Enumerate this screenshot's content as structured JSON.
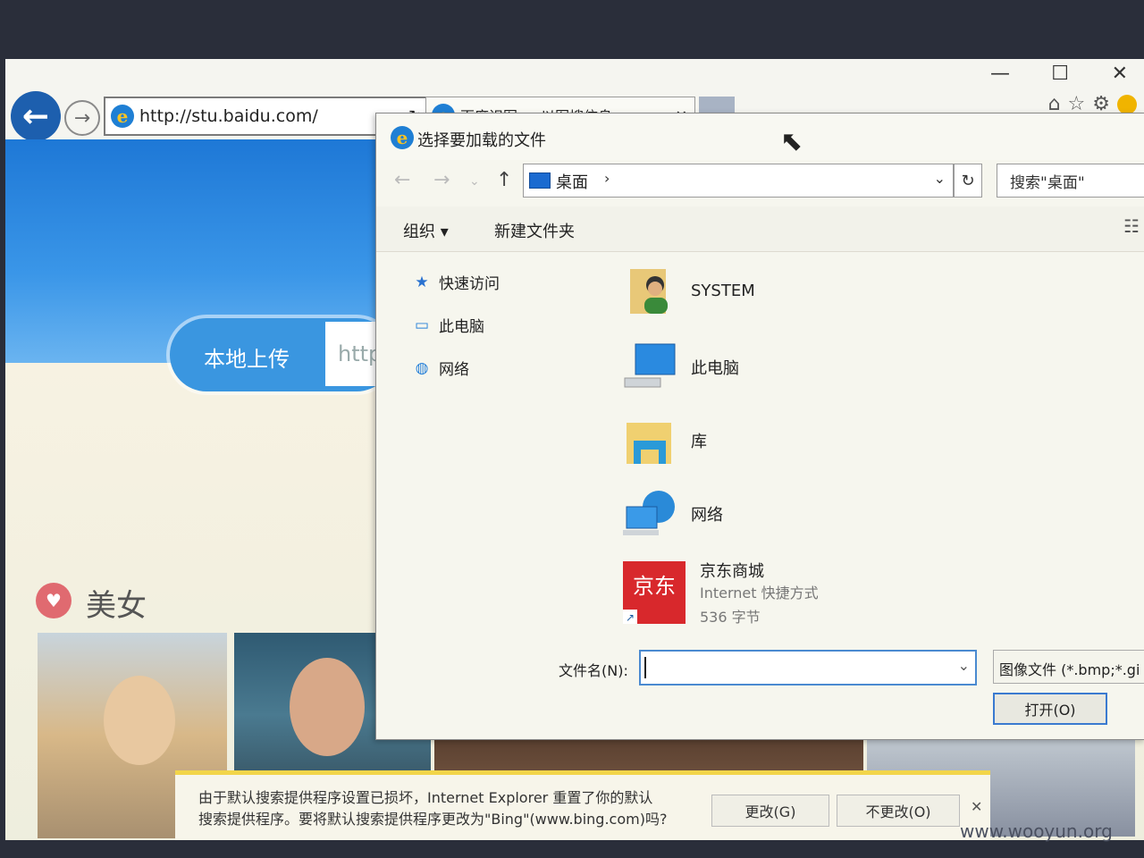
{
  "browser": {
    "address_url": "http://stu.baidu.com/",
    "tab_title": "百度识图 — 以图搜信息",
    "window_controls": [
      "—",
      "☐",
      "✕"
    ]
  },
  "page": {
    "upload_label": "本地上传",
    "url_placeholder": "http",
    "category_title": "美女"
  },
  "dialog": {
    "title": "选择要加载的文件",
    "path": "桌面",
    "search_placeholder": "搜索\"桌面\"",
    "organize_label": "组织 ▾",
    "new_folder_label": "新建文件夹",
    "nav_items": [
      {
        "label": "快速访问",
        "icon": "star-icon"
      },
      {
        "label": "此电脑",
        "icon": "computer-icon"
      },
      {
        "label": "网络",
        "icon": "network-icon"
      }
    ],
    "files": [
      {
        "name": "SYSTEM",
        "icon": "user-folder-icon"
      },
      {
        "name": "此电脑",
        "icon": "computer-icon"
      },
      {
        "name": "库",
        "icon": "library-icon"
      },
      {
        "name": "网络",
        "icon": "network-icon"
      },
      {
        "name": "京东商城",
        "icon": "jd-shortcut-icon",
        "type": "Internet 快捷方式",
        "size": "536 字节"
      }
    ],
    "filename_label": "文件名(N):",
    "filename_value": "",
    "filetype_label": "图像文件 (*.bmp;*.gi",
    "open_button": "打开(O)"
  },
  "notification": {
    "line1": "由于默认搜索提供程序设置已损坏，Internet Explorer 重置了你的默认",
    "line2": "搜索提供程序。要将默认搜索提供程序更改为\"Bing\"(www.bing.com)吗?",
    "change_button": "更改(G)",
    "nochange_button": "不更改(O)",
    "close": "✕"
  },
  "watermark": "www.wooyun.org"
}
